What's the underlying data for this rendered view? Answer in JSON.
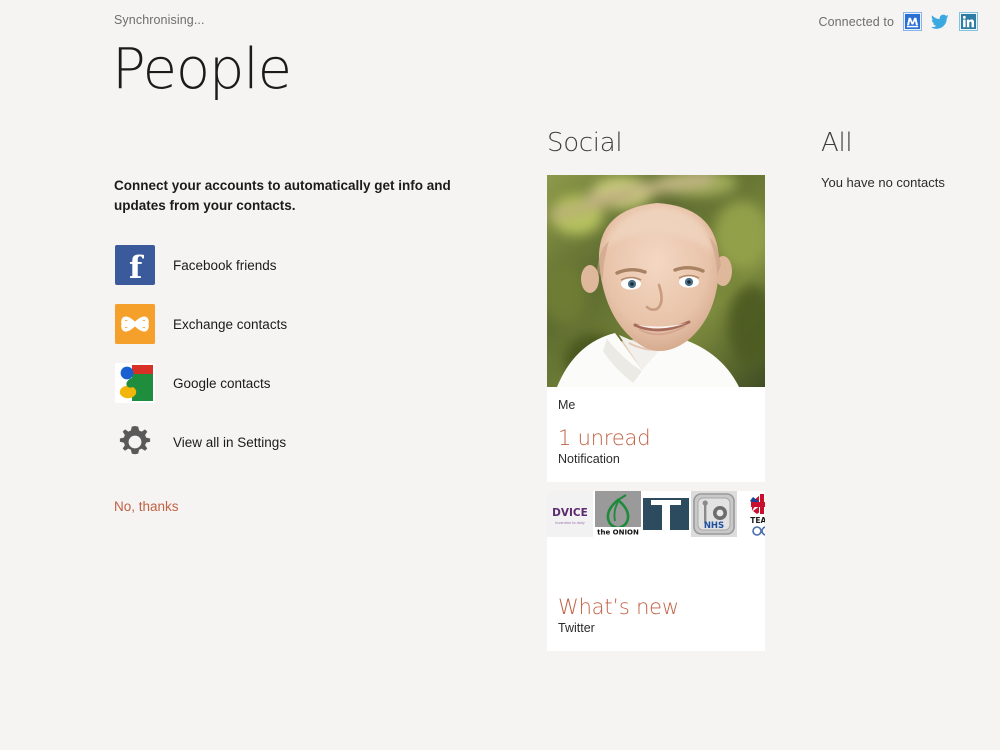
{
  "statusbar": {
    "sync_text": "Synchronising...",
    "connected_label": "Connected to",
    "connected_accounts": [
      {
        "name": "messenger-icon",
        "label": "Messenger",
        "color": "#2b6fd4"
      },
      {
        "name": "twitter-icon",
        "label": "Twitter",
        "color": "#3ba9e0"
      },
      {
        "name": "linkedin-icon",
        "label": "LinkedIn",
        "color": "#2e7ca3"
      }
    ]
  },
  "header": {
    "title": "People"
  },
  "connect": {
    "intro": "Connect your accounts to automatically get info and updates from your contacts.",
    "accounts": [
      {
        "label": "Facebook friends",
        "icon": "facebook-icon"
      },
      {
        "label": "Exchange contacts",
        "icon": "exchange-icon"
      },
      {
        "label": "Google contacts",
        "icon": "google-icon"
      },
      {
        "label": "View all in Settings",
        "icon": "gear-icon"
      }
    ],
    "dismiss_label": "No, thanks"
  },
  "social": {
    "heading": "Social",
    "tiles": [
      {
        "name": "Me",
        "headline": "1 unread",
        "sub": "Notification",
        "photo_alt": "profile-photo"
      },
      {
        "headline": "What’s new",
        "sub": "Twitter",
        "avatars": [
          {
            "name": "dvice-avatar",
            "text": "DVICE"
          },
          {
            "name": "the-onion-avatar",
            "text": "the ONION"
          },
          {
            "name": "t-logo-avatar",
            "text": "T"
          },
          {
            "name": "nhs-safe-avatar",
            "text": "NHS"
          },
          {
            "name": "team-gb-avatar",
            "text": "TEAM"
          }
        ]
      }
    ]
  },
  "all": {
    "heading": "All",
    "empty_text": "You have no contacts"
  },
  "colors": {
    "accent": "#c06245",
    "background": "#f5f4f3",
    "tile_background": "#ffffff",
    "facebook_blue": "#3b5a9b",
    "exchange_orange": "#f5a02a"
  }
}
